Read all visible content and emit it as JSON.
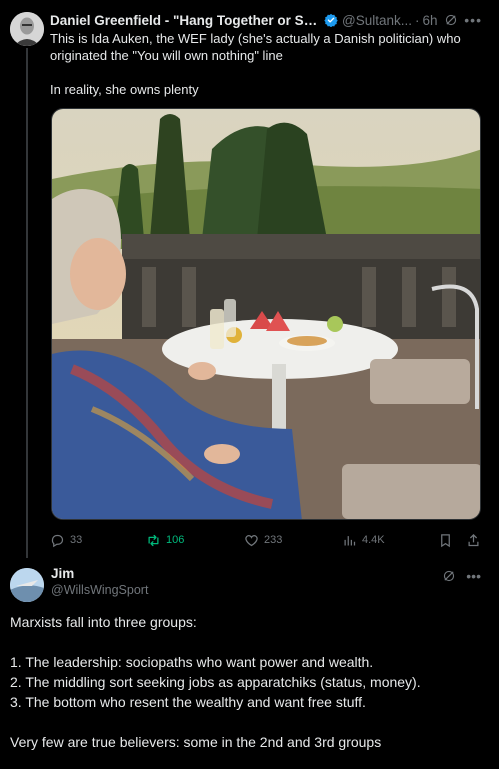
{
  "post1": {
    "author_name": "Daniel Greenfield - \"Hang Together or Sepa...",
    "handle": "@Sultank...",
    "time": "6h",
    "text_line1": "This is Ida Auken, the WEF lady (she's actually a Danish politician) who",
    "text_line2": "originated the \"You will own nothing\" line",
    "text_line3": "In reality, she owns plenty",
    "actions": {
      "replies": "33",
      "reposts": "106",
      "likes": "233",
      "views": "4.4K"
    }
  },
  "post2": {
    "author_name": "Jim",
    "handle": "@WillsWingSport",
    "lines": [
      "Marxists fall into three groups:",
      "1. The leadership: sociopaths who want power and wealth.",
      "2. The middling sort seeking jobs as apparatchiks (status, money).",
      "3. The bottom who resent the wealthy and want free stuff.",
      "Very few are true believers: some in the 2nd and 3rd groups"
    ]
  },
  "colors": {
    "background": "#000000",
    "text": "#e7e9ea",
    "muted": "#71767b",
    "verified": "#1d9bf0",
    "repost_active": "#00ba7c",
    "thread_line": "#333639"
  },
  "icons": [
    "verified-badge-icon",
    "grok-icon",
    "more-icon",
    "reply-icon",
    "repost-icon",
    "like-icon",
    "views-icon",
    "bookmark-icon",
    "share-icon"
  ]
}
